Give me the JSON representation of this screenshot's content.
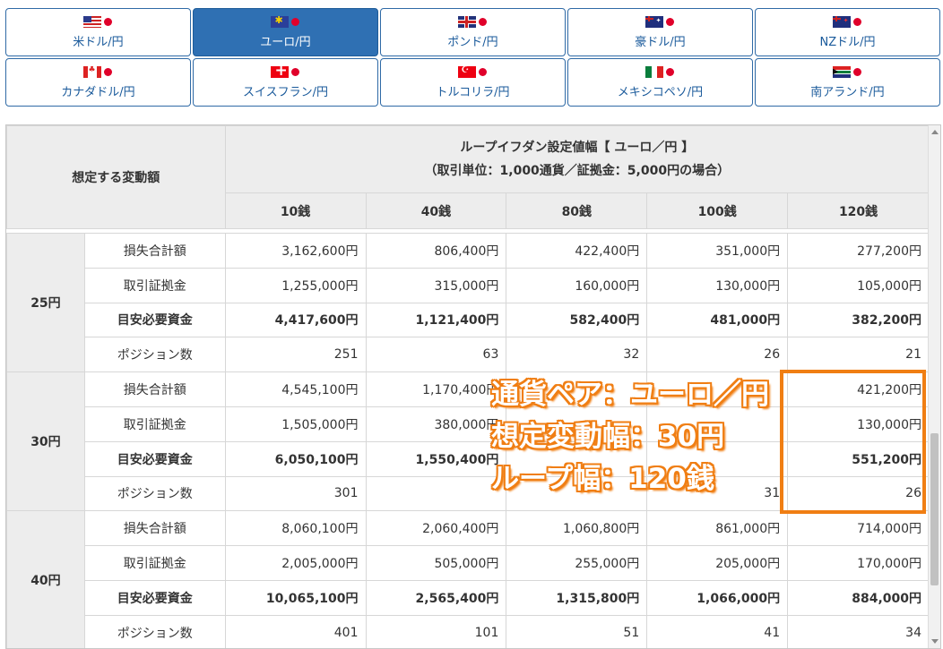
{
  "tabs": [
    [
      {
        "label": "米ドル/円",
        "flag": "us-flag-icon",
        "active": false
      },
      {
        "label": "ユーロ/円",
        "flag": "eu-flag-icon",
        "active": true
      },
      {
        "label": "ポンド/円",
        "flag": "gb-flag-icon",
        "active": false
      },
      {
        "label": "豪ドル/円",
        "flag": "au-flag-icon",
        "active": false
      },
      {
        "label": "NZドル/円",
        "flag": "nz-flag-icon",
        "active": false
      }
    ],
    [
      {
        "label": "カナダドル/円",
        "flag": "ca-flag-icon",
        "active": false
      },
      {
        "label": "スイスフラン/円",
        "flag": "ch-flag-icon",
        "active": false
      },
      {
        "label": "トルコリラ/円",
        "flag": "tr-flag-icon",
        "active": false
      },
      {
        "label": "メキシコペソ/円",
        "flag": "mx-flag-icon",
        "active": false
      },
      {
        "label": "南アランド/円",
        "flag": "za-flag-icon",
        "active": false
      }
    ]
  ],
  "table": {
    "row_header": "想定する変動額",
    "title_line1": "ループイフダン設定値幅【 ユーロ／円 】",
    "title_line2": "（取引単位：1,000通貨／証拠金：5,000円の場合）",
    "columns": [
      "10銭",
      "40銭",
      "80銭",
      "100銭",
      "120銭"
    ],
    "groups": [
      {
        "name": "25円",
        "rows": [
          {
            "label": "損失合計額",
            "values": [
              "3,162,600円",
              "806,400円",
              "422,400円",
              "351,000円",
              "277,200円"
            ],
            "bold": false
          },
          {
            "label": "取引証拠金",
            "values": [
              "1,255,000円",
              "315,000円",
              "160,000円",
              "130,000円",
              "105,000円"
            ],
            "bold": false
          },
          {
            "label": "目安必要資金",
            "values": [
              "4,417,600円",
              "1,121,400円",
              "582,400円",
              "481,000円",
              "382,200円"
            ],
            "bold": true
          },
          {
            "label": "ポジション数",
            "values": [
              "251",
              "63",
              "32",
              "26",
              "21"
            ],
            "bold": false
          }
        ]
      },
      {
        "name": "30円",
        "rows": [
          {
            "label": "損失合計額",
            "values": [
              "4,545,100円",
              "1,170,400円",
              "",
              "",
              "421,200円"
            ],
            "bold": false
          },
          {
            "label": "取引証拠金",
            "values": [
              "1,505,000円",
              "380,000円",
              "",
              "",
              "130,000円"
            ],
            "bold": false
          },
          {
            "label": "目安必要資金",
            "values": [
              "6,050,100円",
              "1,550,400円",
              "",
              "",
              "551,200円"
            ],
            "bold": true
          },
          {
            "label": "ポジション数",
            "values": [
              "301",
              "",
              "",
              "31",
              "26"
            ],
            "bold": false
          }
        ]
      },
      {
        "name": "40円",
        "rows": [
          {
            "label": "損失合計額",
            "values": [
              "8,060,100円",
              "2,060,400円",
              "1,060,800円",
              "861,000円",
              "714,000円"
            ],
            "bold": false
          },
          {
            "label": "取引証拠金",
            "values": [
              "2,005,000円",
              "505,000円",
              "255,000円",
              "205,000円",
              "170,000円"
            ],
            "bold": false
          },
          {
            "label": "目安必要資金",
            "values": [
              "10,065,100円",
              "2,565,400円",
              "1,315,800円",
              "1,066,000円",
              "884,000円"
            ],
            "bold": true
          },
          {
            "label": "ポジション数",
            "values": [
              "401",
              "101",
              "51",
              "41",
              "34"
            ],
            "bold": false
          }
        ]
      }
    ]
  },
  "annotation": {
    "line1": "通貨ペア：ユーロ／円",
    "line2": "想定変動幅：30円",
    "line3": "ループ幅：120銭",
    "color": "#f07e13"
  }
}
